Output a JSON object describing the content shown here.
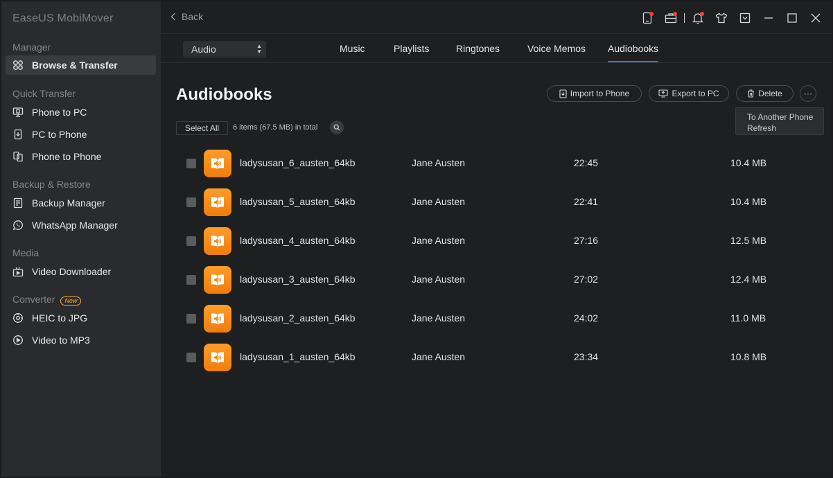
{
  "app": {
    "title": "EaseUS MobiMover"
  },
  "sidebar": {
    "sections": [
      {
        "title": "Manager",
        "items": [
          {
            "label": "Browse & Transfer",
            "icon": "grid-icon",
            "active": true
          }
        ]
      },
      {
        "title": "Quick Transfer",
        "items": [
          {
            "label": "Phone to PC",
            "icon": "phone-to-pc-icon"
          },
          {
            "label": "PC to Phone",
            "icon": "pc-to-phone-icon"
          },
          {
            "label": "Phone to Phone",
            "icon": "phone-to-phone-icon"
          }
        ]
      },
      {
        "title": "Backup & Restore",
        "items": [
          {
            "label": "Backup Manager",
            "icon": "backup-icon"
          },
          {
            "label": "WhatsApp Manager",
            "icon": "whatsapp-icon"
          }
        ]
      },
      {
        "title": "Media",
        "items": [
          {
            "label": "Video Downloader",
            "icon": "video-download-icon"
          }
        ]
      },
      {
        "title": "Converter",
        "badge": "New",
        "items": [
          {
            "label": "HEIC to JPG",
            "icon": "heic-icon"
          },
          {
            "label": "Video to MP3",
            "icon": "video-mp3-icon"
          }
        ]
      }
    ]
  },
  "topbar": {
    "back_label": "Back",
    "icons": [
      "device-icon",
      "toolbox-icon",
      "bell-icon",
      "shirt-icon",
      "download-icon",
      "minimize-icon",
      "maximize-icon",
      "close-icon"
    ]
  },
  "filter": {
    "selected": "Audio"
  },
  "tabs": [
    {
      "label": "Music"
    },
    {
      "label": "Playlists"
    },
    {
      "label": "Ringtones"
    },
    {
      "label": "Voice Memos"
    },
    {
      "label": "Audiobooks",
      "active": true
    }
  ],
  "page": {
    "title": "Audiobooks",
    "actions": {
      "import": "Import to Phone",
      "export": "Export to PC",
      "delete": "Delete",
      "more": "···"
    },
    "more_menu": [
      "To Another Phone",
      "Refresh"
    ],
    "select_all": "Select All",
    "count_text": "6 items (67.5 MB) in total"
  },
  "rows": [
    {
      "name": "ladysusan_6_austen_64kb",
      "author": "Jane Austen",
      "duration": "22:45",
      "size": "10.4 MB"
    },
    {
      "name": "ladysusan_5_austen_64kb",
      "author": "Jane Austen",
      "duration": "22:41",
      "size": "10.4 MB"
    },
    {
      "name": "ladysusan_4_austen_64kb",
      "author": "Jane Austen",
      "duration": "27:16",
      "size": "12.5 MB"
    },
    {
      "name": "ladysusan_3_austen_64kb",
      "author": "Jane Austen",
      "duration": "27:02",
      "size": "12.4 MB"
    },
    {
      "name": "ladysusan_2_austen_64kb",
      "author": "Jane Austen",
      "duration": "24:02",
      "size": "11.0 MB"
    },
    {
      "name": "ladysusan_1_austen_64kb",
      "author": "Jane Austen",
      "duration": "23:34",
      "size": "10.8 MB"
    }
  ],
  "colors": {
    "accent": "#2d7be5",
    "book_icon": "#f58a13",
    "notify": "#ff3b3b",
    "badge_new": "#f6b23c"
  }
}
